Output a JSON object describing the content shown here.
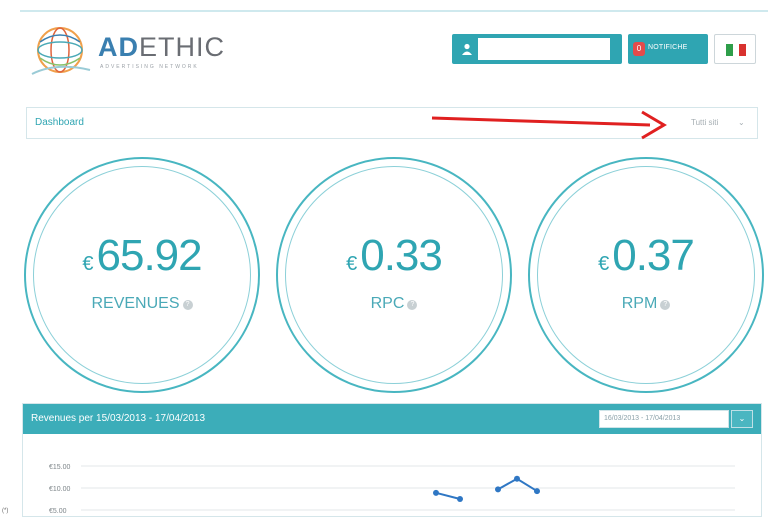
{
  "header": {
    "brand_accent": "AD",
    "brand_rest": "ETHIC",
    "tagline": "ADVERTISING NETWORK",
    "user_name": "",
    "notifications_count": "0",
    "notifications_label": "NOTIFICHE",
    "language_flag": "it-flag-icon"
  },
  "dashboard": {
    "title": "Dashboard",
    "site_select": "Tutti siti"
  },
  "stats": [
    {
      "currency": "€",
      "value": "65.92",
      "label": "REVENUES"
    },
    {
      "currency": "€",
      "value": "0.33",
      "label": "RPC"
    },
    {
      "currency": "€",
      "value": "0.37",
      "label": "RPM"
    }
  ],
  "revenue_panel": {
    "title": "Revenues per 15/03/2013 - 17/04/2013",
    "date_range": "16/03/2013 - 17/04/2013"
  },
  "chart_data": {
    "type": "line",
    "y_ticks": [
      "€15.00",
      "€10.00",
      "€5.00"
    ],
    "ylim": [
      5,
      15
    ],
    "grid": true,
    "series": [
      {
        "x": [
          0,
          1,
          2,
          3,
          4
        ],
        "values": [
          8.9,
          7.5,
          9.7,
          12.1,
          9.3
        ]
      }
    ]
  },
  "footer_note": "(*)",
  "colors": {
    "accent": "#2fa5b2",
    "panel_header": "#3cadb9",
    "badge": "#e44b4b",
    "annotation_arrow": "#e02020"
  }
}
